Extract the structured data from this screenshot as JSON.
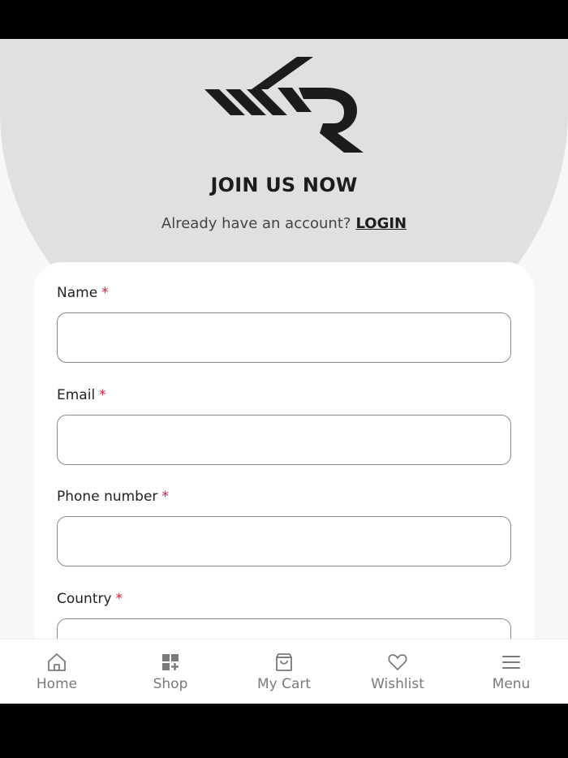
{
  "header": {
    "title": "JOIN US NOW",
    "login_prompt": "Already have an account?",
    "login_link": "LOGIN"
  },
  "form": {
    "required_marker": "*",
    "fields": [
      {
        "label": "Name",
        "value": ""
      },
      {
        "label": "Email",
        "value": ""
      },
      {
        "label": "Phone number",
        "value": ""
      },
      {
        "label": "Country",
        "value": ""
      }
    ]
  },
  "nav": {
    "items": [
      {
        "label": "Home",
        "icon": "home-icon"
      },
      {
        "label": "Shop",
        "icon": "grid-plus-icon"
      },
      {
        "label": "My Cart",
        "icon": "shopping-bag-icon"
      },
      {
        "label": "Wishlist",
        "icon": "heart-icon"
      },
      {
        "label": "Menu",
        "icon": "hamburger-icon"
      }
    ]
  },
  "colors": {
    "header_bg": "#e0e0e0",
    "required": "#d11a3a",
    "text_dark": "#1c1c1c",
    "nav_text": "#7a7a7a"
  }
}
